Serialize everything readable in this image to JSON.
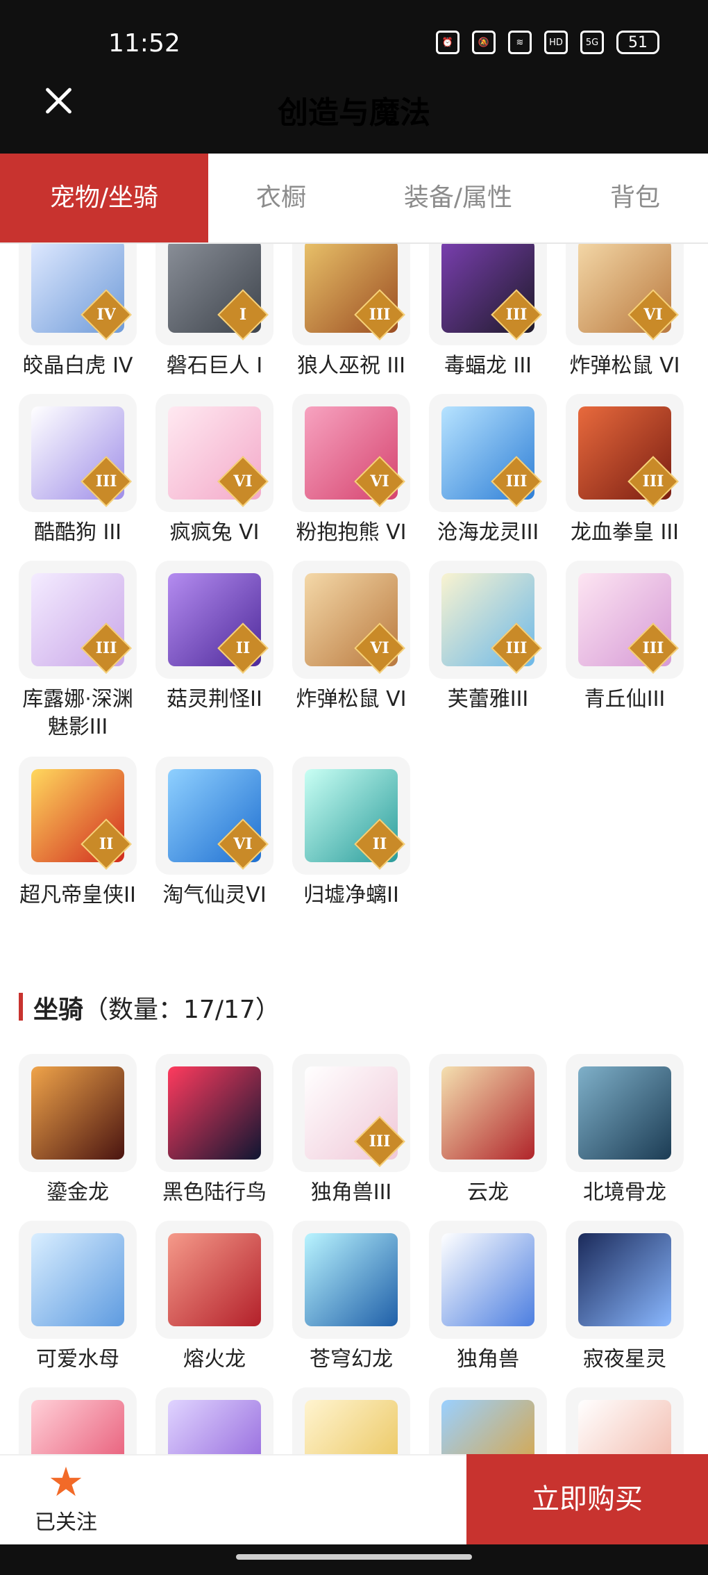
{
  "status_bar": {
    "time": "11:52",
    "battery": "51",
    "network": "5G",
    "hd": "HD"
  },
  "header": {
    "title": "创造与魔法"
  },
  "tabs": [
    {
      "label": "宠物/坐骑",
      "active": true
    },
    {
      "label": "衣橱",
      "active": false
    },
    {
      "label": "装备/属性",
      "active": false
    },
    {
      "label": "背包",
      "active": false
    }
  ],
  "pets": [
    {
      "name": "皎晶白虎 IV",
      "tier": "IV"
    },
    {
      "name": "磐石巨人 I",
      "tier": "I"
    },
    {
      "name": "狼人巫祝 III",
      "tier": "III"
    },
    {
      "name": "毒蝠龙 III",
      "tier": "III"
    },
    {
      "name": "炸弹松鼠 VI",
      "tier": "VI"
    },
    {
      "name": "酷酷狗 III",
      "tier": "III"
    },
    {
      "name": "疯疯兔 VI",
      "tier": "VI"
    },
    {
      "name": "粉抱抱熊 VI",
      "tier": "VI"
    },
    {
      "name": "沧海龙灵III",
      "tier": "III"
    },
    {
      "name": "龙血拳皇 III",
      "tier": "III"
    },
    {
      "name": "库露娜·深渊魅影III",
      "tier": "III"
    },
    {
      "name": "菇灵荆怪II",
      "tier": "II"
    },
    {
      "name": "炸弹松鼠 VI",
      "tier": "VI"
    },
    {
      "name": "芙蕾雅III",
      "tier": "III"
    },
    {
      "name": "青丘仙III",
      "tier": "III"
    },
    {
      "name": "超凡帝皇侠II",
      "tier": "II"
    },
    {
      "name": "淘气仙灵VI",
      "tier": "VI"
    },
    {
      "name": "归墟净螭II",
      "tier": "II"
    }
  ],
  "mounts_section": {
    "title": "坐骑",
    "count": "（数量：17/17）"
  },
  "mounts": [
    {
      "name": "鎏金龙",
      "tier": ""
    },
    {
      "name": "黑色陆行鸟",
      "tier": ""
    },
    {
      "name": "独角兽III",
      "tier": "III"
    },
    {
      "name": "云龙",
      "tier": ""
    },
    {
      "name": "北境骨龙",
      "tier": ""
    },
    {
      "name": "可爱水母",
      "tier": ""
    },
    {
      "name": "熔火龙",
      "tier": ""
    },
    {
      "name": "苍穹幻龙",
      "tier": ""
    },
    {
      "name": "独角兽",
      "tier": ""
    },
    {
      "name": "寂夜星灵",
      "tier": ""
    }
  ],
  "bottom": {
    "follow_label": "已关注",
    "buy_label": "立即购买"
  },
  "colors": {
    "accent": "#c8332f",
    "follow_star": "#f26a28"
  },
  "icons": [
    "close-icon",
    "star-icon",
    "alarm-icon",
    "mute-icon",
    "wifi-icon",
    "signal-icon",
    "battery-icon"
  ]
}
